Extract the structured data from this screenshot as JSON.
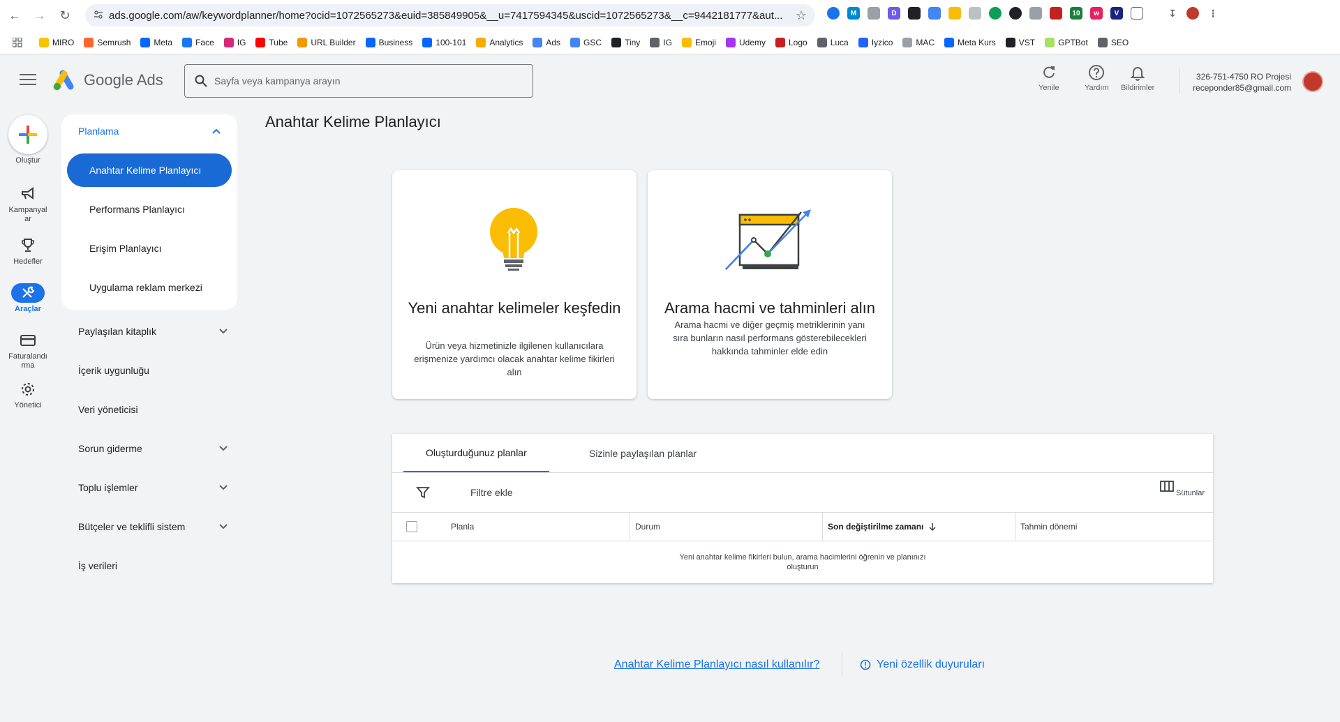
{
  "browser": {
    "url": "ads.google.com/aw/keywordplanner/home?ocid=1072565273&euid=385849905&__u=7417594345&uscid=1072565273&__c=9442181777&aut...",
    "bookmarks": [
      {
        "label": "MIRO",
        "color": "#f7c500"
      },
      {
        "label": "Semrush",
        "color": "#ff642d"
      },
      {
        "label": "Meta",
        "color": "#0866ff"
      },
      {
        "label": "Face",
        "color": "#1877f2"
      },
      {
        "label": "IG",
        "color": "#d62976"
      },
      {
        "label": "Tube",
        "color": "#ff0000"
      },
      {
        "label": "URL Builder",
        "color": "#f29900"
      },
      {
        "label": "Business",
        "color": "#0866ff"
      },
      {
        "label": "100-101",
        "color": "#0866ff"
      },
      {
        "label": "Analytics",
        "color": "#f9ab00"
      },
      {
        "label": "Ads",
        "color": "#4285f4"
      },
      {
        "label": "GSC",
        "color": "#4285f4"
      },
      {
        "label": "Tiny",
        "color": "#202124"
      },
      {
        "label": "IG",
        "color": "#5f6368"
      },
      {
        "label": "Emoji",
        "color": "#fbbc04"
      },
      {
        "label": "Udemy",
        "color": "#a435f0"
      },
      {
        "label": "Logo",
        "color": "#c5221f"
      },
      {
        "label": "Luca",
        "color": "#5f6368"
      },
      {
        "label": "Iyzico",
        "color": "#1e64ff"
      },
      {
        "label": "MAC",
        "color": "#9aa0a6"
      },
      {
        "label": "Meta Kurs",
        "color": "#0866ff"
      },
      {
        "label": "VST",
        "color": "#202124"
      },
      {
        "label": "GPTBot",
        "color": "#a8e063"
      },
      {
        "label": "SEO",
        "color": "#5f6368"
      }
    ],
    "extension_badge": "10"
  },
  "header": {
    "product_name": "Google Ads",
    "search_placeholder": "Sayfa veya kampanya arayın",
    "actions": {
      "refresh": "Yenile",
      "help": "Yardım",
      "notifications": "Bildirimler"
    },
    "account_name": "326-751-4750 RO Projesi",
    "account_email": "receponder85@gmail.com"
  },
  "rail": {
    "create": "Oluştur",
    "campaigns": "Kampanyal ar",
    "goals": "Hedefler",
    "tools": "Araçlar",
    "billing": "Faturalandı rma",
    "admin": "Yönetici"
  },
  "nav": {
    "section": "Planlama",
    "sub_items": [
      "Anahtar Kelime Planlayıcı",
      "Performans Planlayıcı",
      "Erişim Planlayıcı",
      "Uygulama reklam merkezi"
    ],
    "groups": [
      "Paylaşılan kitaplık",
      "İçerik uygunluğu",
      "Veri yöneticisi",
      "Sorun giderme",
      "Toplu işlemler",
      "Bütçeler ve teklifli sistem",
      "İş verileri"
    ]
  },
  "main": {
    "title": "Anahtar Kelime Planlayıcı",
    "cards": [
      {
        "title": "Yeni anahtar kelimeler keşfedin",
        "desc": "Ürün veya hizmetinizle ilgilenen kullanıcılara erişmenize yardımcı olacak anahtar kelime fikirleri alın"
      },
      {
        "title": "Arama hacmi ve tahminleri alın",
        "desc": "Arama hacmi ve diğer geçmiş metriklerinin yanı sıra bunların nasıl performans gösterebilecekleri hakkında tahminler elde edin"
      }
    ],
    "plans": {
      "tabs": [
        "Oluşturduğunuz planlar",
        "Sizinle paylaşılan planlar"
      ],
      "filter_label": "Filtre ekle",
      "columns_label": "Sütunlar",
      "columns": [
        "Planla",
        "Durum",
        "Son değiştirilme zamanı",
        "Tahmin dönemi"
      ],
      "empty_message": "Yeni anahtar kelime fikirleri bulun, arama hacimlerini öğrenin ve planınızı oluşturun"
    },
    "footer": {
      "help_link": "Anahtar Kelime Planlayıcı nasıl kullanılır?",
      "news_link": "Yeni özellik duyuruları"
    }
  },
  "colors": {
    "accent": "#1a73e8",
    "active_nav": "#1a6ad6",
    "background": "#f1f3f4"
  }
}
